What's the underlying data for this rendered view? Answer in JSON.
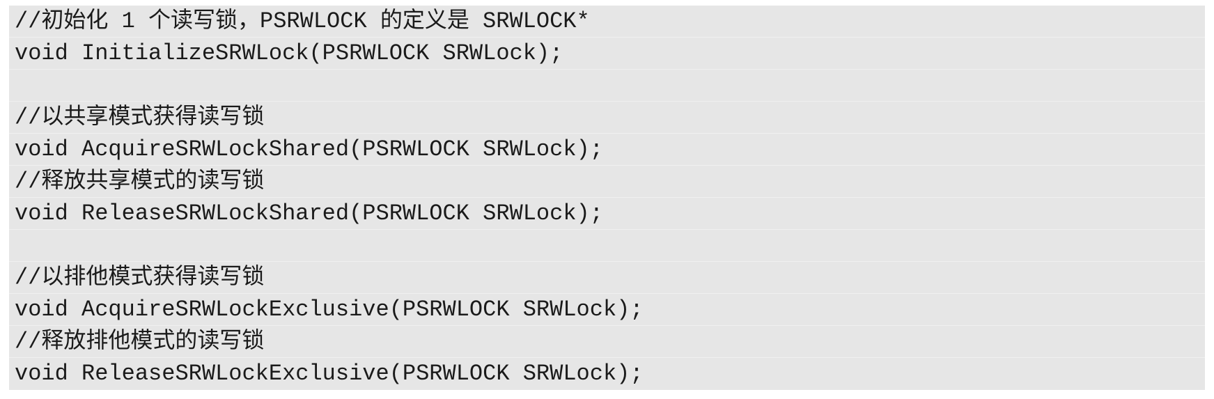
{
  "code": {
    "lines": [
      "//初始化 1 个读写锁，PSRWLOCK 的定义是 SRWLOCK*",
      "void InitializeSRWLock(PSRWLOCK SRWLock);",
      "",
      "//以共享模式获得读写锁",
      "void AcquireSRWLockShared(PSRWLOCK SRWLock);",
      "//释放共享模式的读写锁",
      "void ReleaseSRWLockShared(PSRWLOCK SRWLock);",
      "",
      "//以排他模式获得读写锁",
      "void AcquireSRWLockExclusive(PSRWLOCK SRWLock);",
      "//释放排他模式的读写锁",
      "void ReleaseSRWLockExclusive(PSRWLOCK SRWLock);"
    ]
  }
}
